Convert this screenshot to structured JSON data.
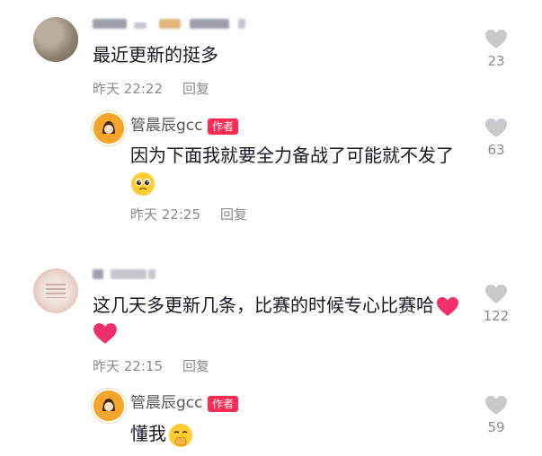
{
  "comments": [
    {
      "text": "最近更新的挺多",
      "time": "昨天 22:22",
      "reply_label": "回复",
      "likes": "23",
      "reply": {
        "author": "管晨辰gcc",
        "badge": "作者",
        "text": "因为下面我就要全力备战了可能就不发了",
        "emoji": "pleading-face-emoji",
        "time": "昨天 22:25",
        "reply_label": "回复",
        "likes": "63"
      }
    },
    {
      "text": "这几天多更新几条，比赛的时候专心比赛哈",
      "emoji": "heart-emoji",
      "time": "昨天 22:15",
      "reply_label": "回复",
      "likes": "122",
      "reply": {
        "author": "管晨辰gcc",
        "badge": "作者",
        "text": "懂我",
        "emoji": "hand-over-mouth-emoji",
        "likes": "59"
      }
    }
  ],
  "colors": {
    "badge": "#fe2c55",
    "heart": "#f0306a",
    "avatar_gcc": "#f4a62a",
    "muted": "#8a8b91"
  }
}
